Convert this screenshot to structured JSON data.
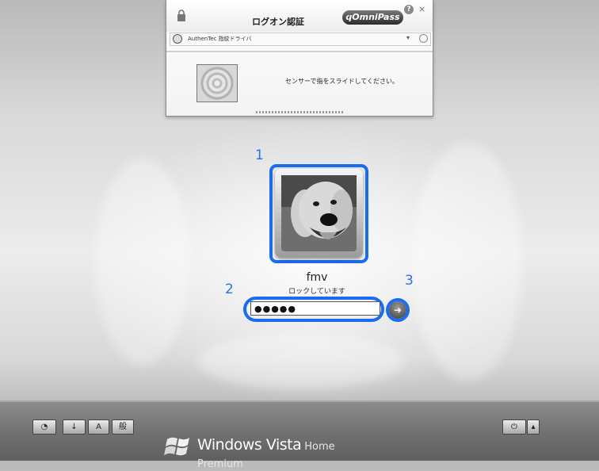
{
  "fingerprint_dialog": {
    "title": "ログオン認証",
    "brand": "OmniPass",
    "help_label": "?",
    "close_label": "×",
    "driver": "AuthenTec 指紋ドライバ",
    "instruction": "センサーで指をスライドしてください。"
  },
  "callouts": {
    "tile": "1",
    "password": "2",
    "submit": "3"
  },
  "user": {
    "name": "fmv",
    "status": "ロックしています",
    "password_value": "●●●●●"
  },
  "submit_arrow": "➜",
  "bottom_buttons": {
    "ease_of_access": "◔",
    "input_indicator": "↓",
    "ime_mode": "A",
    "ime_kanji": "般",
    "power": "⏻",
    "power_menu": "▴"
  },
  "branding": {
    "windows": "Windows",
    "vista": "Vista",
    "edition": "Home Premium"
  },
  "colors": {
    "highlight": "#1b6cf0",
    "callout_number": "#2f6df0"
  }
}
